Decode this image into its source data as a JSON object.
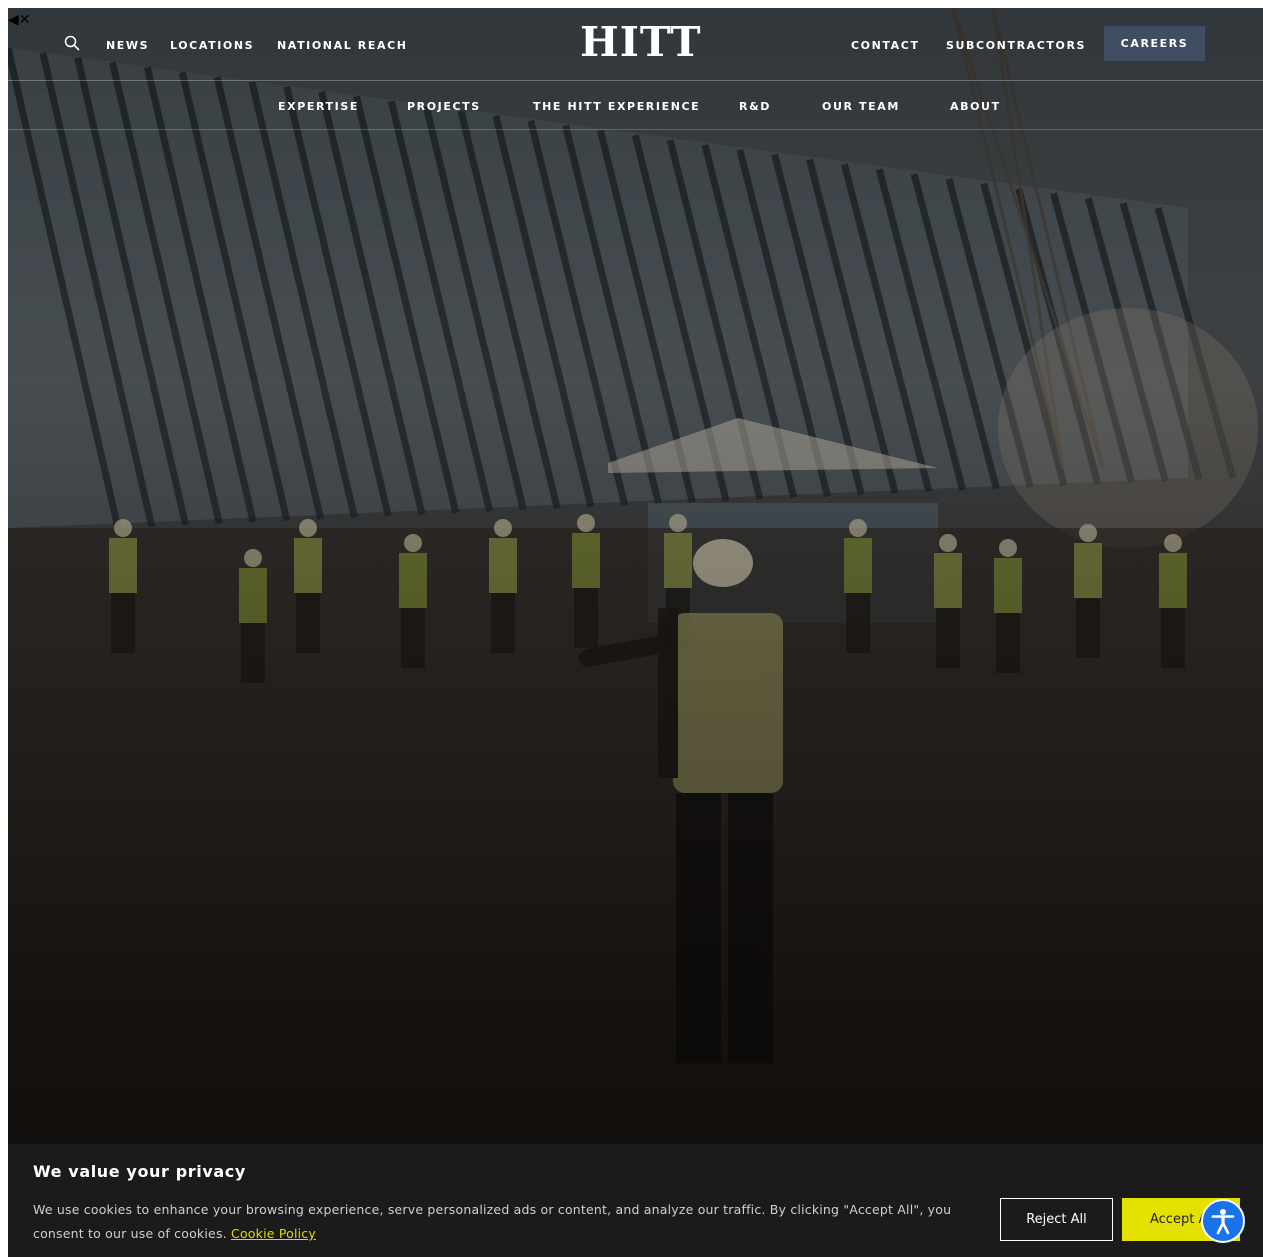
{
  "header": {
    "logo": "HITT",
    "left_links": [
      "NEWS",
      "LOCATIONS",
      "NATIONAL REACH"
    ],
    "right_links": [
      "CONTACT",
      "SUBCONTRACTORS"
    ],
    "careers_label": "CAREERS",
    "search_icon": "search-icon",
    "mute_icon": "◀✕"
  },
  "subnav": {
    "items": [
      "EXPERTISE",
      "PROJECTS",
      "THE HITT EXPERIENCE",
      "R&D",
      "OUR TEAM",
      "ABOUT"
    ]
  },
  "cookie": {
    "title": "We value your privacy",
    "text": "We use cookies to enhance your browsing experience, serve personalized ads or content, and analyze our traffic. By clicking \"Accept All\", you consent to our use of cookies.",
    "link": "Cookie Policy",
    "reject_label": "Reject All",
    "accept_label": "Accept All"
  },
  "colors": {
    "careers_bg": "#3f4e60",
    "accept_bg": "#e4e000",
    "cookie_link": "#e3d900",
    "a11y_bg": "#1a73e8"
  },
  "accessibility": {
    "icon": "accessibility-icon"
  }
}
